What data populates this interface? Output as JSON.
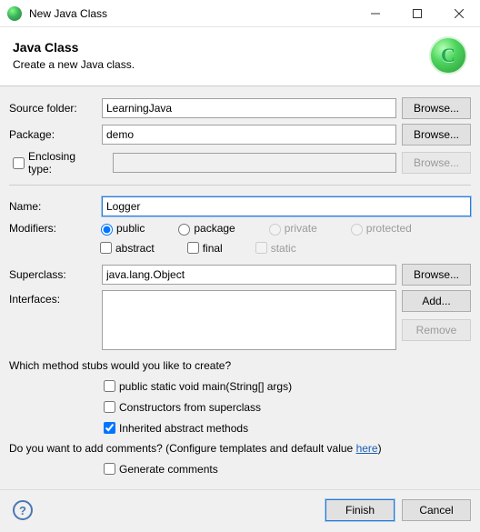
{
  "window": {
    "title": "New Java Class"
  },
  "header": {
    "title": "Java Class",
    "subtitle": "Create a new Java class."
  },
  "labels": {
    "sourceFolder": "Source folder:",
    "package": "Package:",
    "enclosingType": "Enclosing type:",
    "name": "Name:",
    "modifiers": "Modifiers:",
    "superclass": "Superclass:",
    "interfaces": "Interfaces:"
  },
  "values": {
    "sourceFolder": "LearningJava",
    "package": "demo",
    "enclosingType": "",
    "name": "Logger",
    "superclass": "java.lang.Object"
  },
  "buttons": {
    "browse": "Browse...",
    "add": "Add...",
    "remove": "Remove",
    "finish": "Finish",
    "cancel": "Cancel"
  },
  "modifiers": {
    "public": "public",
    "package": "package",
    "private": "private",
    "protected": "protected",
    "abstract": "abstract",
    "final": "final",
    "static": "static"
  },
  "stubs": {
    "question": "Which method stubs would you like to create?",
    "main": "public static void main(String[] args)",
    "constructors": "Constructors from superclass",
    "inherited": "Inherited abstract methods"
  },
  "comments": {
    "question_pre": "Do you want to add comments? (Configure templates and default value ",
    "link": "here",
    "question_post": ")",
    "generate": "Generate comments"
  }
}
